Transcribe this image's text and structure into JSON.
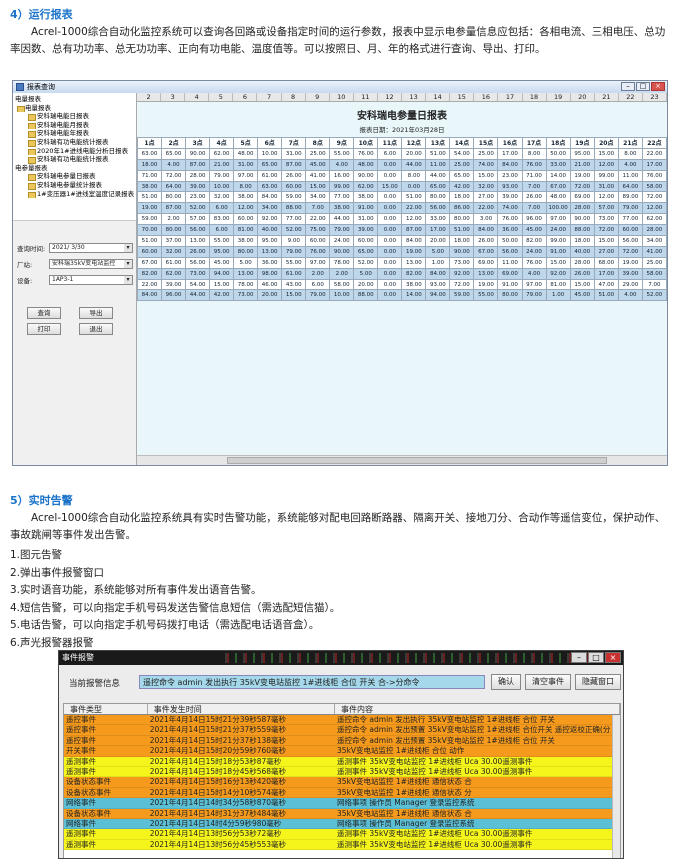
{
  "section4": {
    "title": "4）运行报表",
    "body": "Acrel-1000综合自动化监控系统可以查询各回路或设备指定时间的运行参数，报表中显示电参量信息应包括：各相电流、三相电压、总功率因数、总有功功率、总无功功率、正向有功电能、温度值等。可以按照日、月、年的格式进行查询、导出、打印。"
  },
  "report_window": {
    "title": "报表查询",
    "tree": [
      {
        "level": 0,
        "label": "电量报表"
      },
      {
        "level": 1,
        "label": "电量报表"
      },
      {
        "level": 2,
        "label": "安科瑞电能日报表"
      },
      {
        "level": 2,
        "label": "安科瑞电能月报表"
      },
      {
        "level": 2,
        "label": "安科瑞电能年报表"
      },
      {
        "level": 2,
        "label": "安科瑞有功电能统计报表"
      },
      {
        "level": 2,
        "label": "2020年1#进线电能分析日报表"
      },
      {
        "level": 2,
        "label": "安科瑞有功电能统计报表"
      },
      {
        "level": 0,
        "label": "电参量报表"
      },
      {
        "level": 2,
        "label": "安科瑞电参量日报表"
      },
      {
        "level": 2,
        "label": "安科瑞电参量统计报表"
      },
      {
        "level": 2,
        "label": "1#变压器1#进线室温度记录报表"
      }
    ],
    "filters": {
      "date_label": "查询时间:",
      "date_value": "2021/ 3/30",
      "factory_label": "厂站:",
      "factory_value": "安科瑞35kV变电站监控",
      "device_label": "设备:",
      "device_value": "1AP3-1"
    },
    "buttons": {
      "query": "查询",
      "export": "导出",
      "print": "打印",
      "exit": "退出"
    },
    "column_numbers": [
      "2",
      "3",
      "4",
      "5",
      "6",
      "7",
      "8",
      "9",
      "10",
      "11",
      "12",
      "13",
      "14",
      "15",
      "16",
      "17",
      "18",
      "19",
      "20",
      "21",
      "22",
      "23"
    ],
    "report_title": "安科瑞电参量日报表",
    "report_date": "报表日期：2021年03月28日",
    "headers": [
      "1点",
      "2点",
      "3点",
      "4点",
      "5点",
      "6点",
      "7点",
      "8点",
      "9点",
      "10点",
      "11点",
      "12点",
      "13点",
      "14点",
      "15点",
      "16点",
      "17点",
      "18点",
      "19点",
      "20点",
      "21点",
      "22点"
    ],
    "rows": [
      [
        "63.00",
        "65.00",
        "90.00",
        "62.00",
        "48.00",
        "10.00",
        "31.00",
        "25.00",
        "55.00",
        "76.00",
        "6.00",
        "20.00",
        "51.00",
        "54.00",
        "25.00",
        "17.00",
        "8.00",
        "50.00",
        "95.00",
        "15.00",
        "8.00",
        "22.00"
      ],
      [
        "18.00",
        "4.00",
        "87.00",
        "21.00",
        "31.00",
        "65.00",
        "87.00",
        "45.00",
        "4.00",
        "48.00",
        "0.00",
        "44.00",
        "11.00",
        "25.00",
        "74.00",
        "84.00",
        "76.00",
        "33.00",
        "21.00",
        "12.00",
        "4.00",
        "17.00"
      ],
      [
        "71.00",
        "72.00",
        "28.00",
        "79.00",
        "97.00",
        "61.00",
        "26.00",
        "41.00",
        "16.00",
        "90.00",
        "0.00",
        "8.00",
        "44.00",
        "65.00",
        "15.00",
        "23.00",
        "71.00",
        "14.00",
        "19.00",
        "99.00",
        "11.00",
        "76.00"
      ],
      [
        "38.00",
        "64.00",
        "39.00",
        "10.00",
        "8.00",
        "63.00",
        "60.00",
        "15.00",
        "99.00",
        "62.00",
        "15.00",
        "0.00",
        "65.00",
        "42.00",
        "32.00",
        "93.00",
        "7.00",
        "67.00",
        "72.00",
        "31.00",
        "64.00",
        "58.00"
      ],
      [
        "51.00",
        "80.00",
        "23.00",
        "32.00",
        "38.00",
        "84.00",
        "59.00",
        "34.00",
        "77.00",
        "38.00",
        "0.00",
        "51.00",
        "80.00",
        "18.00",
        "27.00",
        "39.00",
        "26.00",
        "48.00",
        "69.00",
        "12.00",
        "89.00",
        "72.00"
      ],
      [
        "19.00",
        "87.00",
        "52.00",
        "6.00",
        "12.00",
        "34.00",
        "88.00",
        "7.00",
        "38.00",
        "91.00",
        "0.00",
        "22.00",
        "56.00",
        "86.00",
        "22.00",
        "74.00",
        "7.00",
        "100.00",
        "28.00",
        "57.00",
        "79.00",
        "12.00"
      ],
      [
        "59.00",
        "2.00",
        "57.00",
        "83.00",
        "60.00",
        "92.00",
        "77.00",
        "22.00",
        "44.00",
        "31.00",
        "0.00",
        "12.00",
        "33.00",
        "80.00",
        "3.00",
        "76.00",
        "96.00",
        "97.00",
        "90.00",
        "73.00",
        "77.00",
        "62.00"
      ],
      [
        "70.00",
        "80.00",
        "56.00",
        "6.00",
        "81.00",
        "40.00",
        "52.00",
        "75.00",
        "79.00",
        "39.00",
        "0.00",
        "87.00",
        "17.00",
        "51.00",
        "84.00",
        "36.00",
        "45.00",
        "24.00",
        "88.00",
        "72.00",
        "60.00",
        "28.00"
      ],
      [
        "51.00",
        "37.00",
        "13.00",
        "55.00",
        "38.00",
        "95.00",
        "9.00",
        "60.00",
        "24.00",
        "60.00",
        "0.00",
        "84.00",
        "20.00",
        "18.00",
        "26.00",
        "50.00",
        "82.00",
        "99.00",
        "18.00",
        "15.00",
        "56.00",
        "34.00"
      ],
      [
        "60.00",
        "32.00",
        "26.00",
        "95.00",
        "80.00",
        "13.00",
        "79.00",
        "76.00",
        "90.00",
        "65.00",
        "0.00",
        "19.00",
        "5.00",
        "90.00",
        "67.00",
        "56.00",
        "24.00",
        "91.00",
        "40.00",
        "27.00",
        "72.00",
        "41.00"
      ],
      [
        "67.00",
        "61.00",
        "56.00",
        "45.00",
        "5.00",
        "36.00",
        "55.00",
        "97.00",
        "78.00",
        "52.00",
        "0.00",
        "13.00",
        "1.00",
        "73.00",
        "69.00",
        "11.00",
        "76.00",
        "15.00",
        "28.00",
        "68.00",
        "19.00",
        "25.00"
      ],
      [
        "82.00",
        "62.00",
        "73.00",
        "94.00",
        "13.00",
        "98.00",
        "61.00",
        "2.00",
        "2.00",
        "5.00",
        "0.00",
        "82.00",
        "84.00",
        "92.00",
        "13.00",
        "69.00",
        "4.00",
        "92.00",
        "26.00",
        "17.00",
        "39.00",
        "58.00"
      ],
      [
        "22.00",
        "39.00",
        "54.00",
        "15.00",
        "78.00",
        "46.00",
        "43.00",
        "6.00",
        "58.00",
        "20.00",
        "0.00",
        "38.00",
        "93.00",
        "72.00",
        "19.00",
        "91.00",
        "97.00",
        "81.00",
        "15.00",
        "47.00",
        "29.00",
        "7.00"
      ],
      [
        "84.00",
        "96.00",
        "44.00",
        "42.00",
        "73.00",
        "20.00",
        "15.00",
        "79.00",
        "10.00",
        "88.00",
        "0.00",
        "14.00",
        "94.00",
        "59.00",
        "55.00",
        "80.00",
        "79.00",
        "1.00",
        "45.00",
        "51.00",
        "4.00",
        "52.00"
      ]
    ]
  },
  "section5": {
    "title": "5）实时告警",
    "body": "Acrel-1000综合自动化监控系统具有实时告警功能，系统能够对配电回路断路器、隔离开关、接地刀分、合动作等遥信变位，保护动作、事故跳闸等事件发出告警。",
    "items": [
      "1.图元告警",
      "2.弹出事件报警窗口",
      "3.实时语音功能，系统能够对所有事件发出语音告警。",
      "4.短信告警，可以向指定手机号码发送告警信息短信（需选配短信猫）。",
      "5.电话告警，可以向指定手机号码拨打电话（需选配电话语音盒）。",
      "6.声光报警器报警"
    ]
  },
  "alarm_window": {
    "title": "事件报警",
    "current_label": "当前报警信息",
    "current_message": "遥控命令 admin 发出执行 35kV变电站监控 1#进线柜 合位 开关 合->分命令",
    "buttons": {
      "confirm": "确认",
      "clear": "清空事件",
      "hide": "隐藏窗口"
    },
    "headers": [
      "事件类型",
      "事件发生时间",
      "事件内容"
    ],
    "rows": [
      {
        "type": "遥控事件",
        "time": "2021年4月14日15时21分39秒587毫秒",
        "content": "遥控命令 admin 发出执行 35kV变电站监控 1#进线柜 合位 开关",
        "color": "#f59a1c"
      },
      {
        "type": "遥控事件",
        "time": "2021年4月14日15时21分37秒559毫秒",
        "content": "遥控命令 admin 发出预置 35kV变电站监控 1#进线柜 合位开关 遥控返校正确(分",
        "color": "#f59a1c"
      },
      {
        "type": "遥控事件",
        "time": "2021年4月14日15时21分37秒138毫秒",
        "content": "遥控命令 admin 发出预置 35kV变电站监控 1#进线柜 合位 开关",
        "color": "#f59a1c"
      },
      {
        "type": "开关事件",
        "time": "2021年4月14日15时20分59秒760毫秒",
        "content": "35kV变电站监控 1#进线柜 合位 动作",
        "color": "#f59a1c"
      },
      {
        "type": "遥测事件",
        "time": "2021年4月14日15时18分53秒87毫秒",
        "content": "遥测事件 35kV变电站监控 1#进线柜 Uca 30.00遥测事件",
        "color": "#f5f51c"
      },
      {
        "type": "遥测事件",
        "time": "2021年4月14日15时18分45秒568毫秒",
        "content": "遥测事件 35kV变电站监控 1#进线柜 Uca 30.00遥测事件",
        "color": "#f5f51c"
      },
      {
        "type": "设备状态事件",
        "time": "2021年4月14日15时16分13秒420毫秒",
        "content": "35kV变电站监控 1#进线柜 通信状态 合",
        "color": "#f59a1c"
      },
      {
        "type": "设备状态事件",
        "time": "2021年4月14日15时14分10秒574毫秒",
        "content": "35kV变电站监控 1#进线柜 通信状态 分",
        "color": "#f59a1c"
      },
      {
        "type": "网络事件",
        "time": "2021年4月14日14时34分58秒870毫秒",
        "content": "网络事项 操作员 Manager 登录监控系统",
        "color": "#5bbfd6"
      },
      {
        "type": "设备状态事件",
        "time": "2021年4月14日14时31分37秒484毫秒",
        "content": "35kV变电站监控 1#进线柜 通信状态 合",
        "color": "#f59a1c"
      },
      {
        "type": "网络事件",
        "time": "2021年4月14日14时4分59秒980毫秒",
        "content": "网络事项 操作员 Manager 登录监控系统",
        "color": "#5bbfd6"
      },
      {
        "type": "遥测事件",
        "time": "2021年4月14日13时56分53秒72毫秒",
        "content": "遥测事件 35kV变电站监控 1#进线柜 Uca 30.00遥测事件",
        "color": "#f5f51c"
      },
      {
        "type": "遥测事件",
        "time": "2021年4月14日13时56分45秒553毫秒",
        "content": "遥测事件 35kV变电站监控 1#进线柜 Uca 30.00遥测事件",
        "color": "#f5f51c"
      }
    ]
  }
}
